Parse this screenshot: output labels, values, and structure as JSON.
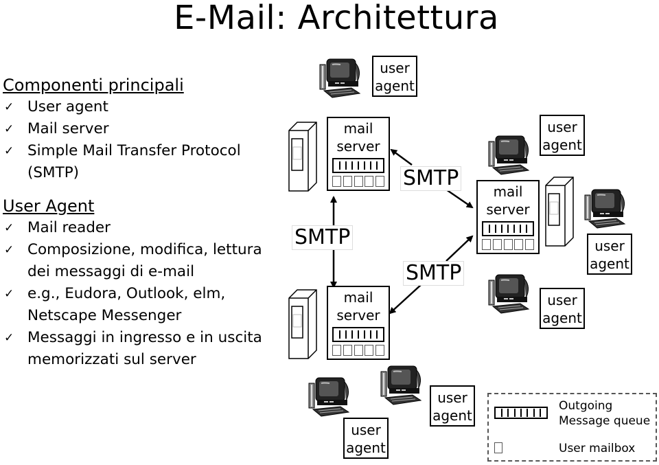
{
  "title": "E-Mail: Architettura",
  "sections": [
    {
      "heading": "Componenti principali",
      "items": [
        "User agent",
        "Mail server",
        "Simple Mail Transfer Protocol (SMTP)"
      ]
    },
    {
      "heading": "User Agent",
      "items": [
        "Mail reader",
        "Composizione, modifica, lettura dei messaggi di e-mail",
        "e.g., Eudora, Outlook, elm, Netscape Messenger",
        "Messaggi in ingresso e in uscita memorizzati sul server"
      ]
    }
  ],
  "check_icon": "✓",
  "diagram": {
    "user_agent_label": [
      "user",
      "agent"
    ],
    "mail_server_label": [
      "mail",
      "server"
    ],
    "protocol_label": "SMTP",
    "legend": {
      "queue_label": [
        "Outgoing",
        "Message queue"
      ],
      "mailbox_label": "User mailbox"
    }
  }
}
